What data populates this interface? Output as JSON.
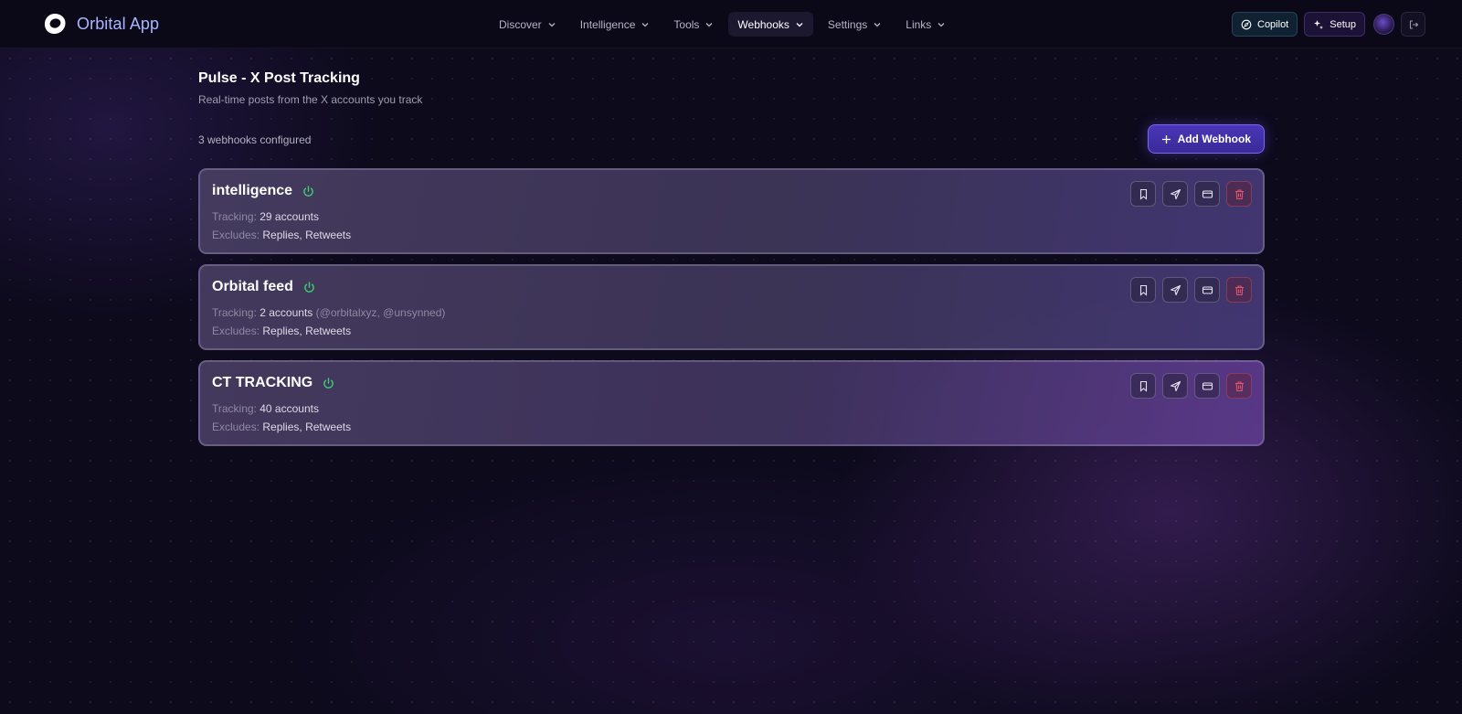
{
  "app": {
    "name": "Orbital App",
    "logo_icon": "orbital-logo-icon"
  },
  "nav": {
    "items": [
      {
        "label": "Discover",
        "active": false
      },
      {
        "label": "Intelligence",
        "active": false
      },
      {
        "label": "Tools",
        "active": false
      },
      {
        "label": "Webhooks",
        "active": true
      },
      {
        "label": "Settings",
        "active": false
      },
      {
        "label": "Links",
        "active": false
      }
    ],
    "copilot_label": "Copilot",
    "setup_label": "Setup"
  },
  "page": {
    "title": "Pulse - X Post Tracking",
    "subtitle": "Real-time posts from the X accounts you track",
    "count_text": "3 webhooks configured",
    "add_button_label": "Add Webhook"
  },
  "labels": {
    "tracking": "Tracking:",
    "excludes": "Excludes:"
  },
  "webhooks": [
    {
      "name": "intelligence",
      "tracking": "29 accounts",
      "tracking_extra": "",
      "excludes": "Replies, Retweets",
      "enabled": true
    },
    {
      "name": "Orbital feed",
      "tracking": "2 accounts",
      "tracking_extra": "(@orbitalxyz, @unsynned)",
      "excludes": "Replies, Retweets",
      "enabled": true
    },
    {
      "name": "CT TRACKING",
      "tracking": "40 accounts",
      "tracking_extra": "",
      "excludes": "Replies, Retweets",
      "enabled": true
    }
  ],
  "colors": {
    "accent": "#4a36b8",
    "power_on": "#3ecf6e",
    "danger": "#e0566e",
    "brand_text": "#a9b6ff"
  }
}
